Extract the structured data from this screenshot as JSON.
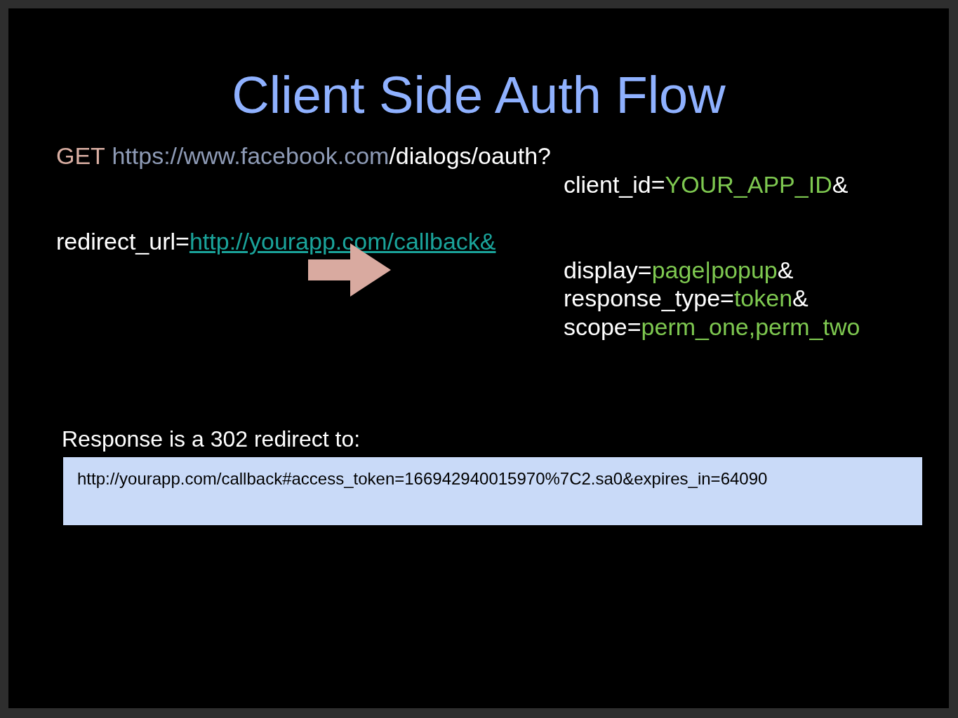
{
  "slide": {
    "title": "Client Side Auth Flow",
    "request_lines": [
      {
        "kind": "flush",
        "segments": [
          {
            "kind": "method",
            "text": "GET"
          },
          {
            "kind": "host",
            "text": "https://www.facebook.com"
          },
          {
            "kind": "text",
            "text": "/dialogs/oauth?"
          }
        ]
      },
      {
        "kind": "indented",
        "segments": [
          {
            "kind": "text",
            "text": "client_id="
          },
          {
            "kind": "value",
            "text": "YOUR_APP_ID"
          },
          {
            "kind": "text",
            "text": "&"
          }
        ]
      },
      {
        "kind": "spaced",
        "segments": [
          {
            "kind": "text",
            "text": "redirect_url="
          },
          {
            "kind": "link",
            "text": "http://yourapp.com/callback&"
          }
        ]
      },
      {
        "kind": "indented",
        "segments": [
          {
            "kind": "text",
            "text": "display="
          },
          {
            "kind": "value",
            "text": "page|popup"
          },
          {
            "kind": "text",
            "text": "&"
          }
        ]
      },
      {
        "kind": "indented",
        "segments": [
          {
            "kind": "text",
            "text": "response_type="
          },
          {
            "kind": "value",
            "text": "token"
          },
          {
            "kind": "text",
            "text": "&"
          }
        ]
      },
      {
        "kind": "indented",
        "segments": [
          {
            "kind": "text",
            "text": "scope="
          },
          {
            "kind": "value",
            "text": "perm_one,perm_two"
          }
        ]
      }
    ],
    "response_label": "Response is a 302 redirect to:",
    "response_url": "http://yourapp.com/callback#access_token=166942940015970%7C2.sa0&expires_in=64090"
  }
}
